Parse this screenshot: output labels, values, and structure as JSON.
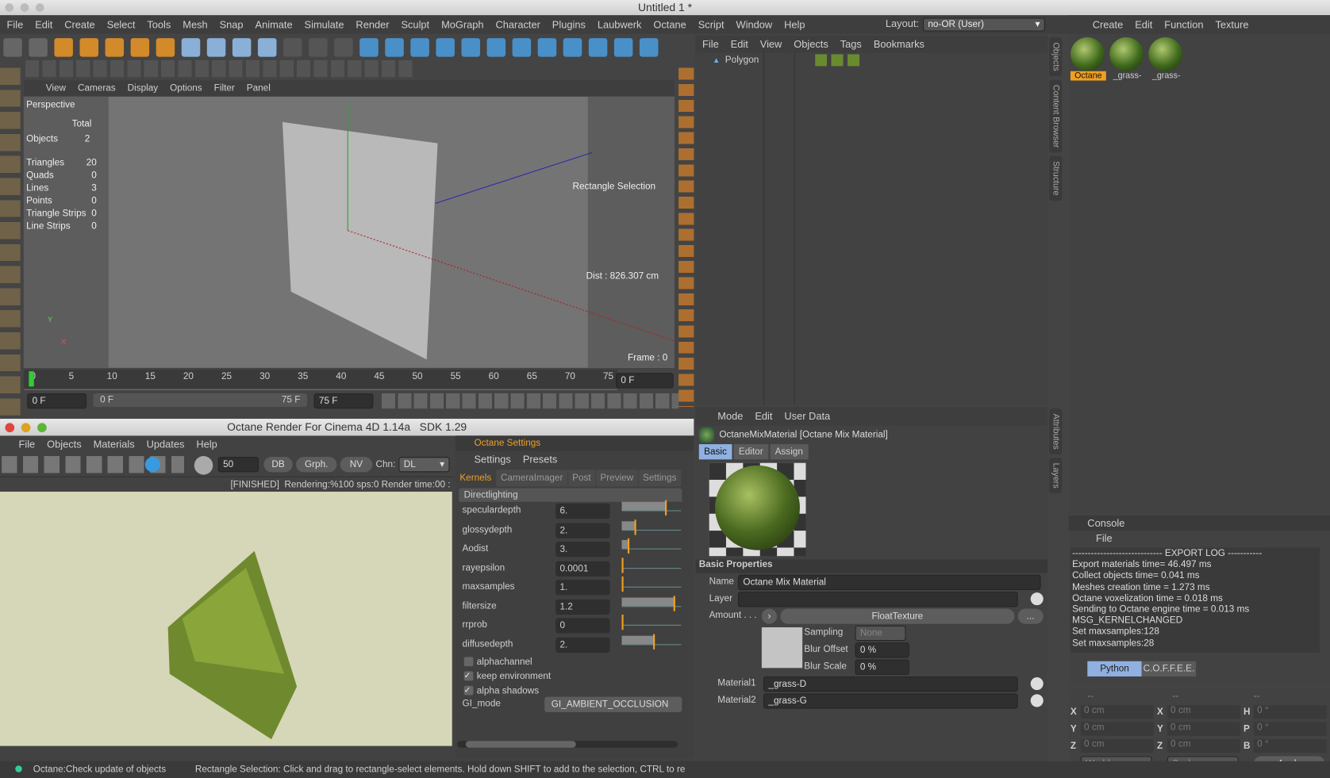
{
  "window": {
    "title": "Untitled 1 *"
  },
  "menubar": {
    "items": [
      "File",
      "Edit",
      "Create",
      "Select",
      "Tools",
      "Mesh",
      "Snap",
      "Animate",
      "Simulate",
      "Render",
      "Sculpt",
      "MoGraph",
      "Character",
      "Plugins",
      "Laubwerk",
      "Octane",
      "Script",
      "Window",
      "Help"
    ],
    "layout_label": "Layout:",
    "layout_value": "no-OR (User)"
  },
  "toolbar": {
    "icons": [
      "undo-icon",
      "redo-icon",
      "live-selection-icon",
      "move-icon",
      "scale-icon",
      "rotate-icon",
      "recent-tool-icon",
      "x-axis-icon",
      "y-axis-icon",
      "z-axis-icon",
      "coordinate-system-icon",
      "render-view-icon",
      "render-picture-viewer-icon",
      "edit-render-settings-icon",
      "cube-icon",
      "spline-pen-icon",
      "subdivision-icon",
      "array-icon",
      "deformer-icon",
      "floor-icon",
      "camera-icon",
      "light-icon",
      "grid-icon",
      "snap-icon",
      "layer-icon",
      "save-icon"
    ]
  },
  "viewport": {
    "menu": [
      "View",
      "Cameras",
      "Display",
      "Options",
      "Filter",
      "Panel"
    ],
    "label": "Perspective",
    "stats_header": "Total",
    "objects_label": "Objects",
    "objects_value": "2",
    "stats": [
      {
        "label": "Triangles",
        "value": "20"
      },
      {
        "label": "Quads",
        "value": "0"
      },
      {
        "label": "Lines",
        "value": "3"
      },
      {
        "label": "Points",
        "value": "0"
      },
      {
        "label": "Triangle Strips",
        "value": "0"
      },
      {
        "label": "Line Strips",
        "value": "0"
      }
    ],
    "tool_hint": "Rectangle Selection",
    "distance": "Dist : 826.307 cm",
    "frame": "Frame : 0"
  },
  "timeline": {
    "ticks": [
      "0",
      "5",
      "10",
      "15",
      "20",
      "25",
      "30",
      "35",
      "40",
      "45",
      "50",
      "55",
      "60",
      "65",
      "70",
      "75"
    ],
    "current": "0 F",
    "start": "0 F",
    "range_start": "0 F",
    "range_end": "75 F",
    "end": "75 F"
  },
  "object_manager": {
    "menu": [
      "File",
      "Edit",
      "View",
      "Objects",
      "Tags",
      "Bookmarks"
    ],
    "objects": [
      {
        "name": "Polygon"
      }
    ]
  },
  "side_tabs_top": [
    "Objects",
    "Content Browser",
    "Structure"
  ],
  "side_tabs_bottom": [
    "Attributes",
    "Layers"
  ],
  "material_manager": {
    "menu": [
      "Create",
      "Edit",
      "Function",
      "Texture"
    ],
    "materials": [
      {
        "name": "Octane",
        "selected": true
      },
      {
        "name": "_grass-"
      },
      {
        "name": "_grass-"
      }
    ]
  },
  "attributes": {
    "menu": [
      "Mode",
      "Edit",
      "User Data"
    ],
    "title": "OctaneMixMaterial [Octane Mix Material]",
    "tabs": [
      "Basic",
      "Editor",
      "Assign"
    ],
    "active_tab": "Basic",
    "section": "Basic Properties",
    "name_label": "Name",
    "name_value": "Octane Mix Material",
    "layer_label": "Layer",
    "layer_value": "",
    "amount_label": "Amount . . .",
    "amount_button": "FloatTexture",
    "more_button": "...",
    "sampling_label": "Sampling",
    "sampling_value": "None",
    "blur_offset_label": "Blur Offset",
    "blur_offset_value": "0 %",
    "blur_scale_label": "Blur Scale",
    "blur_scale_value": "0 %",
    "material1_label": "Material1",
    "material1_value": "_grass-D",
    "material2_label": "Material2",
    "material2_value": "_grass-G"
  },
  "console": {
    "title": "Console",
    "menu": [
      "File"
    ],
    "lines": [
      "----------------------------- EXPORT LOG -----------",
      "Export materials time= 46.497 ms",
      "Collect objects time= 0.041 ms",
      "Meshes creation time = 1.273 ms",
      "Octane voxelization time = 0.018 ms",
      "Sending to Octane engine time = 0.013 ms",
      "MSG_KERNELCHANGED",
      "Set maxsamples:128",
      "Set maxsamples:28"
    ],
    "tabs": [
      "Python",
      "C.O.F.F.E.E."
    ]
  },
  "coords": {
    "headers": [
      "--",
      "--",
      "--"
    ],
    "rows": [
      {
        "a": "X",
        "av": "0 cm",
        "b": "X",
        "bv": "0 cm",
        "c": "H",
        "cv": "0 °"
      },
      {
        "a": "Y",
        "av": "0 cm",
        "b": "Y",
        "bv": "0 cm",
        "c": "P",
        "cv": "0 °"
      },
      {
        "a": "Z",
        "av": "0 cm",
        "b": "Z",
        "bv": "0 cm",
        "c": "B",
        "cv": "0 °"
      }
    ],
    "mode1": "World",
    "mode2": "Scale",
    "apply": "Apply"
  },
  "octane": {
    "title": "Octane Render For Cinema 4D 1.14a   SDK 1.29",
    "menu": [
      "File",
      "Objects",
      "Materials",
      "Updates",
      "Help"
    ],
    "samples": "50",
    "buttons": [
      "DB",
      "Grph.",
      "NV"
    ],
    "channel_label": "Chn:",
    "channel_value": "DL",
    "status": "[FINISHED]  Rendering:%100 sps:0 Render time:00 :"
  },
  "octane_settings": {
    "title": "Octane Settings",
    "menu": [
      "Settings",
      "Presets"
    ],
    "tabs": [
      "Kernels",
      "CameraImager",
      "Post",
      "Preview",
      "Settings"
    ],
    "active_tab": "Kernels",
    "group": "Directlighting",
    "params": [
      {
        "label": "speculardepth",
        "value": "6.",
        "fill": 0.75
      },
      {
        "label": "glossydepth",
        "value": "2.",
        "fill": 0.22
      },
      {
        "label": "Aodist",
        "value": "3.",
        "fill": 0.1
      },
      {
        "label": "rayepsilon",
        "value": "0.0001",
        "fill": 0.0
      },
      {
        "label": "maxsamples",
        "value": "1.",
        "fill": 0.0
      },
      {
        "label": "filtersize",
        "value": "1.2",
        "fill": 0.9
      },
      {
        "label": "rrprob",
        "value": "0",
        "fill": 0.0
      },
      {
        "label": "diffusedepth",
        "value": "2.",
        "fill": 0.55
      }
    ],
    "checks": [
      {
        "label": "alphachannel",
        "checked": false
      },
      {
        "label": "keep environment",
        "checked": true
      },
      {
        "label": "alpha shadows",
        "checked": true
      }
    ],
    "gi_label": "GI_mode",
    "gi_value": "GI_AMBIENT_OCCLUSION"
  },
  "statusbar": {
    "left": "Octane:Check update of objects",
    "right": "Rectangle Selection: Click and drag to rectangle-select elements. Hold down SHIFT to add to the selection, CTRL to re"
  },
  "colors": {
    "accent": "#f0a020",
    "selection": "#8fb0e0",
    "panel": "#424242"
  }
}
